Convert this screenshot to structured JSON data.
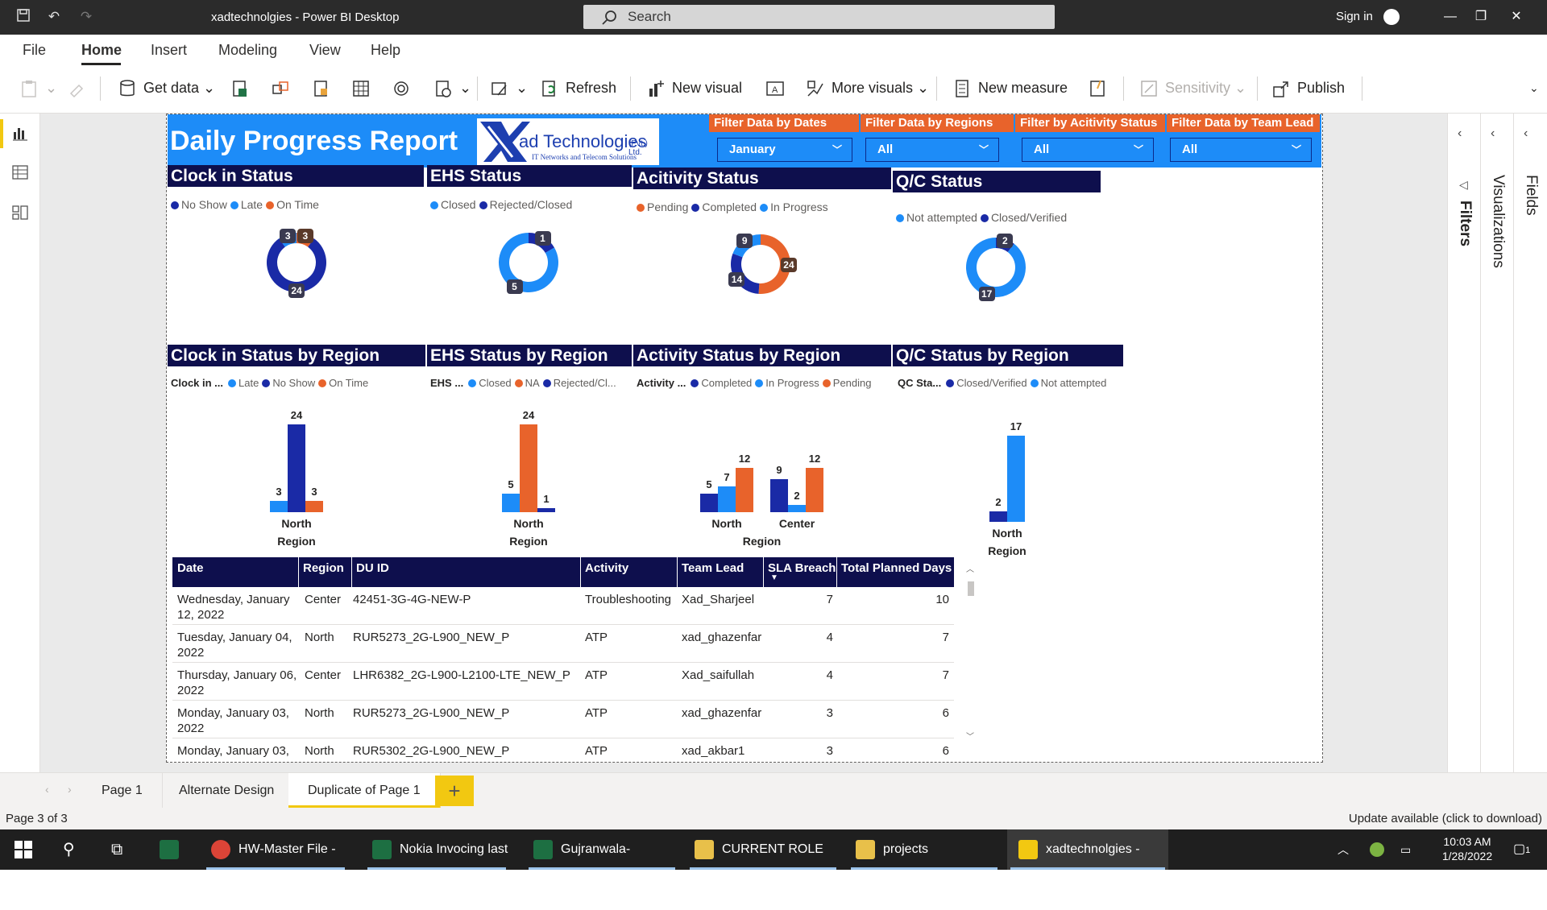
{
  "app": {
    "title": "xadtechnolgies - Power BI Desktop",
    "search_placeholder": "Search",
    "sign_in": "Sign in"
  },
  "menu": [
    "File",
    "Home",
    "Insert",
    "Modeling",
    "View",
    "Help"
  ],
  "ribbon": {
    "get_data": "Get data",
    "refresh": "Refresh",
    "new_visual": "New visual",
    "more_visuals": "More visuals",
    "new_measure": "New measure",
    "sensitivity": "Sensitivity",
    "publish": "Publish"
  },
  "right_panes": {
    "filters": "Filters",
    "visualizations": "Visualizations",
    "fields": "Fields"
  },
  "report": {
    "title": "Daily Progress Report",
    "logo_line1": "ad Technologies",
    "logo_suffix": "(Pvt.) Ltd.",
    "logo_line2": "IT Networks and Telecom Solutions",
    "filters": [
      {
        "label": "Filter Data by Dates",
        "value": "January"
      },
      {
        "label": "Filter Data by Regions",
        "value": "All"
      },
      {
        "label": "Filter by Acitivity Status",
        "value": "All"
      },
      {
        "label": "Filter Data by Team Lead",
        "value": "All"
      }
    ]
  },
  "colors": {
    "dark_blue": "#1a2aa6",
    "light_blue": "#1d8cf8",
    "orange": "#e8632b",
    "navy": "#0e0f4d"
  },
  "donuts": [
    {
      "title": "Clock in Status",
      "legend": [
        {
          "name": "No Show",
          "color": "#1a2aa6"
        },
        {
          "name": "Late",
          "color": "#1d8cf8"
        },
        {
          "name": "On Time",
          "color": "#e8632b"
        }
      ],
      "chart_data": {
        "type": "pie",
        "labels": [
          "On Time",
          "No Show",
          "Late"
        ],
        "values": [
          3,
          24,
          3
        ],
        "colors": [
          "#e8632b",
          "#1a2aa6",
          "#1d8cf8"
        ]
      }
    },
    {
      "title": "EHS Status",
      "legend": [
        {
          "name": "Closed",
          "color": "#1d8cf8"
        },
        {
          "name": "Rejected/Closed",
          "color": "#1a2aa6"
        }
      ],
      "chart_data": {
        "type": "pie",
        "labels": [
          "Rejected/Closed",
          "Closed"
        ],
        "values": [
          1,
          5
        ],
        "colors": [
          "#1a2aa6",
          "#1d8cf8"
        ]
      }
    },
    {
      "title": "Acitivity Status",
      "legend": [
        {
          "name": "Pending",
          "color": "#e8632b"
        },
        {
          "name": "Completed",
          "color": "#1a2aa6"
        },
        {
          "name": "In Progress",
          "color": "#1d8cf8"
        }
      ],
      "chart_data": {
        "type": "pie",
        "labels": [
          "Pending",
          "Completed",
          "In Progress"
        ],
        "values": [
          24,
          14,
          9
        ],
        "colors": [
          "#e8632b",
          "#1a2aa6",
          "#1d8cf8"
        ]
      }
    },
    {
      "title": "Q/C Status",
      "legend": [
        {
          "name": "Not attempted",
          "color": "#1d8cf8"
        },
        {
          "name": "Closed/Verified",
          "color": "#1a2aa6"
        }
      ],
      "chart_data": {
        "type": "pie",
        "labels": [
          "Closed/Verified",
          "Not attempted"
        ],
        "values": [
          2,
          17
        ],
        "colors": [
          "#1a2aa6",
          "#1d8cf8"
        ]
      }
    }
  ],
  "bar_charts": [
    {
      "title": "Clock in Status by Region",
      "legend_title": "Clock in ...",
      "legend": [
        {
          "name": "Late",
          "color": "#1d8cf8"
        },
        {
          "name": "No Show",
          "color": "#1a2aa6"
        },
        {
          "name": "On Time",
          "color": "#e8632b"
        }
      ],
      "chart_data": {
        "type": "bar",
        "xlabel": "Region",
        "categories": [
          "North"
        ],
        "series": [
          {
            "name": "Late",
            "color": "#1d8cf8",
            "values": [
              3
            ]
          },
          {
            "name": "No Show",
            "color": "#1a2aa6",
            "values": [
              24
            ]
          },
          {
            "name": "On Time",
            "color": "#e8632b",
            "values": [
              3
            ]
          }
        ]
      }
    },
    {
      "title": "EHS Status by Region",
      "legend_title": "EHS ...",
      "legend": [
        {
          "name": "Closed",
          "color": "#1d8cf8"
        },
        {
          "name": "NA",
          "color": "#e8632b"
        },
        {
          "name": "Rejected/Cl...",
          "color": "#1a2aa6"
        }
      ],
      "chart_data": {
        "type": "bar",
        "xlabel": "Region",
        "categories": [
          "North"
        ],
        "series": [
          {
            "name": "Closed",
            "color": "#1d8cf8",
            "values": [
              5
            ]
          },
          {
            "name": "NA",
            "color": "#e8632b",
            "values": [
              24
            ]
          },
          {
            "name": "Rejected/Cl...",
            "color": "#1a2aa6",
            "values": [
              1
            ]
          }
        ]
      }
    },
    {
      "title": "Activity Status by Region",
      "legend_title": "Activity ...",
      "legend": [
        {
          "name": "Completed",
          "color": "#1a2aa6"
        },
        {
          "name": "In Progress",
          "color": "#1d8cf8"
        },
        {
          "name": "Pending",
          "color": "#e8632b"
        }
      ],
      "chart_data": {
        "type": "bar",
        "xlabel": "Region",
        "categories": [
          "North",
          "Center"
        ],
        "series": [
          {
            "name": "Completed",
            "color": "#1a2aa6",
            "values": [
              5,
              9
            ]
          },
          {
            "name": "In Progress",
            "color": "#1d8cf8",
            "values": [
              7,
              2
            ]
          },
          {
            "name": "Pending",
            "color": "#e8632b",
            "values": [
              12,
              12
            ]
          }
        ]
      }
    },
    {
      "title": "Q/C Status by Region",
      "legend_title": "QC Sta...",
      "legend": [
        {
          "name": "Closed/Verified",
          "color": "#1a2aa6"
        },
        {
          "name": "Not attempted",
          "color": "#1d8cf8"
        }
      ],
      "chart_data": {
        "type": "bar",
        "xlabel": "Region",
        "categories": [
          "North"
        ],
        "series": [
          {
            "name": "Closed/Verified",
            "color": "#1a2aa6",
            "values": [
              2
            ]
          },
          {
            "name": "Not attempted",
            "color": "#1d8cf8",
            "values": [
              17
            ]
          }
        ]
      }
    }
  ],
  "table": {
    "columns": [
      "Date",
      "Region",
      "DU ID",
      "Activity",
      "Team Lead",
      "SLA Breach",
      "Total Planned Days"
    ],
    "rows": [
      [
        "Wednesday, January 12, 2022",
        "Center",
        "42451-3G-4G-NEW-P",
        "Troubleshooting",
        "Xad_Sharjeel",
        "7",
        "10"
      ],
      [
        "Tuesday, January 04, 2022",
        "North",
        "RUR5273_2G-L900_NEW_P",
        "ATP",
        "xad_ghazenfar",
        "4",
        "7"
      ],
      [
        "Thursday, January 06, 2022",
        "Center",
        "LHR6382_2G-L900-L2100-LTE_NEW_P",
        "ATP",
        "Xad_saifullah",
        "4",
        "7"
      ],
      [
        "Monday, January 03, 2022",
        "North",
        "RUR5273_2G-L900_NEW_P",
        "ATP",
        "xad_ghazenfar",
        "3",
        "6"
      ],
      [
        "Monday, January 03,",
        "North",
        "RUR5302_2G-L900_NEW_P",
        "ATP",
        "xad_akbar1",
        "3",
        "6"
      ]
    ]
  },
  "pages": [
    "Page 1",
    "Alternate Design",
    "Duplicate of Page 1"
  ],
  "status": {
    "page": "Page 3 of 3",
    "update": "Update available (click to download)"
  },
  "taskbar": {
    "items": [
      "HW-Master File - G...",
      "Nokia Invocing last ...",
      "Gujranwala- Master...",
      "CURRENT ROLE",
      "projects",
      "xadtechnolgies - Po..."
    ],
    "time": "10:03 AM",
    "date": "1/28/2022",
    "notif": "1"
  }
}
